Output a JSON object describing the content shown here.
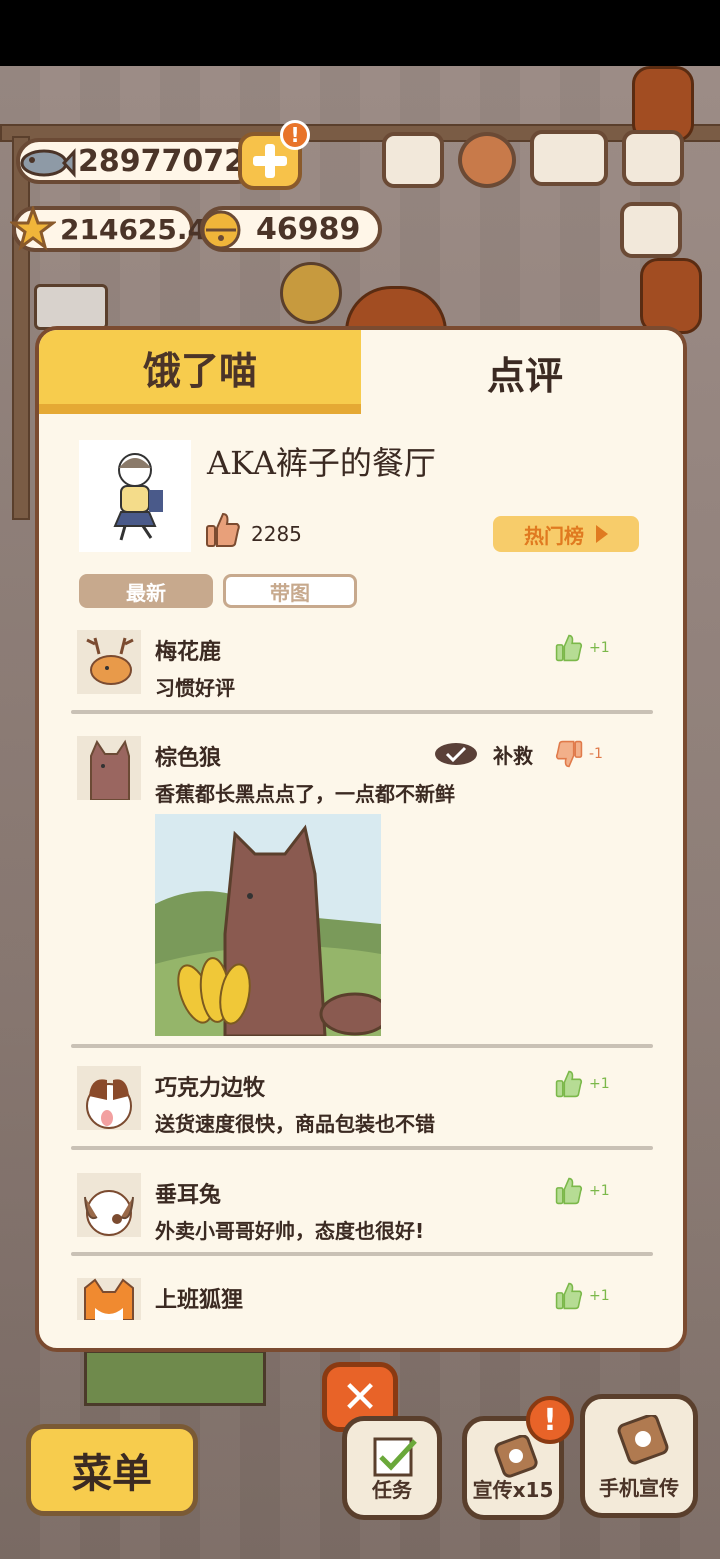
{
  "currency": {
    "fish": "28977072",
    "stars": "214625.4",
    "bells": "46989",
    "alert_mark": "!"
  },
  "tabs": {
    "hungry": "饿了喵",
    "review": "点评"
  },
  "restaurant": {
    "name": "AKA裤子的餐厅",
    "likes": "2285",
    "hot_label": "热门榜"
  },
  "filters": {
    "newest": "最新",
    "with_pics": "带图"
  },
  "reviews": [
    {
      "name": "梅花鹿",
      "text": "习惯好评",
      "vote": "+1",
      "type": "up"
    },
    {
      "name": "棕色狼",
      "text": "香蕉都长黑点点了，一点都不新鲜",
      "vote": "-1",
      "type": "down",
      "remedy": "补救"
    },
    {
      "name": "巧克力边牧",
      "text": "送货速度很快，商品包装也不错",
      "vote": "+1",
      "type": "up"
    },
    {
      "name": "垂耳兔",
      "text": "外卖小哥哥好帅，态度也很好!",
      "vote": "+1",
      "type": "up"
    },
    {
      "name": "上班狐狸",
      "text": "",
      "vote": "+1",
      "type": "up"
    }
  ],
  "bottom": {
    "menu": "菜单",
    "close": "✕",
    "tasks": "任务",
    "promo": "宣传x15",
    "phone_promo": "手机宣传"
  },
  "colors": {
    "panel_border": "#7b4b30",
    "tab_active": "#f7cc4d",
    "like_green": "#7bb84a",
    "dislike_orange": "#e07a4a"
  }
}
